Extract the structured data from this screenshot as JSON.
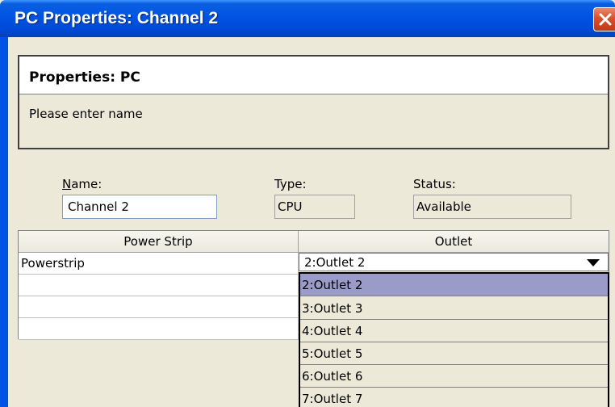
{
  "window": {
    "title": "PC Properties: Channel 2"
  },
  "header": {
    "title": "Properties: PC",
    "subtitle": "Please enter name"
  },
  "fields": {
    "name_label_accel": "N",
    "name_label_rest": "ame:",
    "name_value": "Channel 2",
    "type_label": "Type:",
    "type_value": "CPU",
    "status_label": "Status:",
    "status_value": "Available"
  },
  "grid": {
    "columns": [
      "Power Strip",
      "Outlet"
    ],
    "rows": [
      {
        "power_strip": "Powerstrip",
        "outlet": "2:Outlet 2"
      },
      {
        "power_strip": "",
        "outlet": ""
      },
      {
        "power_strip": "",
        "outlet": ""
      },
      {
        "power_strip": "",
        "outlet": ""
      }
    ]
  },
  "dropdown": {
    "selected": "2:Outlet 2",
    "options": [
      "2:Outlet 2",
      "3:Outlet 3",
      "4:Outlet 4",
      "5:Outlet 5",
      "6:Outlet 6",
      "7:Outlet 7"
    ]
  },
  "colors": {
    "titlebar": "#0054e3",
    "selection": "#9a9bc9",
    "close_button": "#d8502c"
  },
  "icons": {
    "close": "close-icon",
    "dropdown": "triangle-down-icon"
  }
}
